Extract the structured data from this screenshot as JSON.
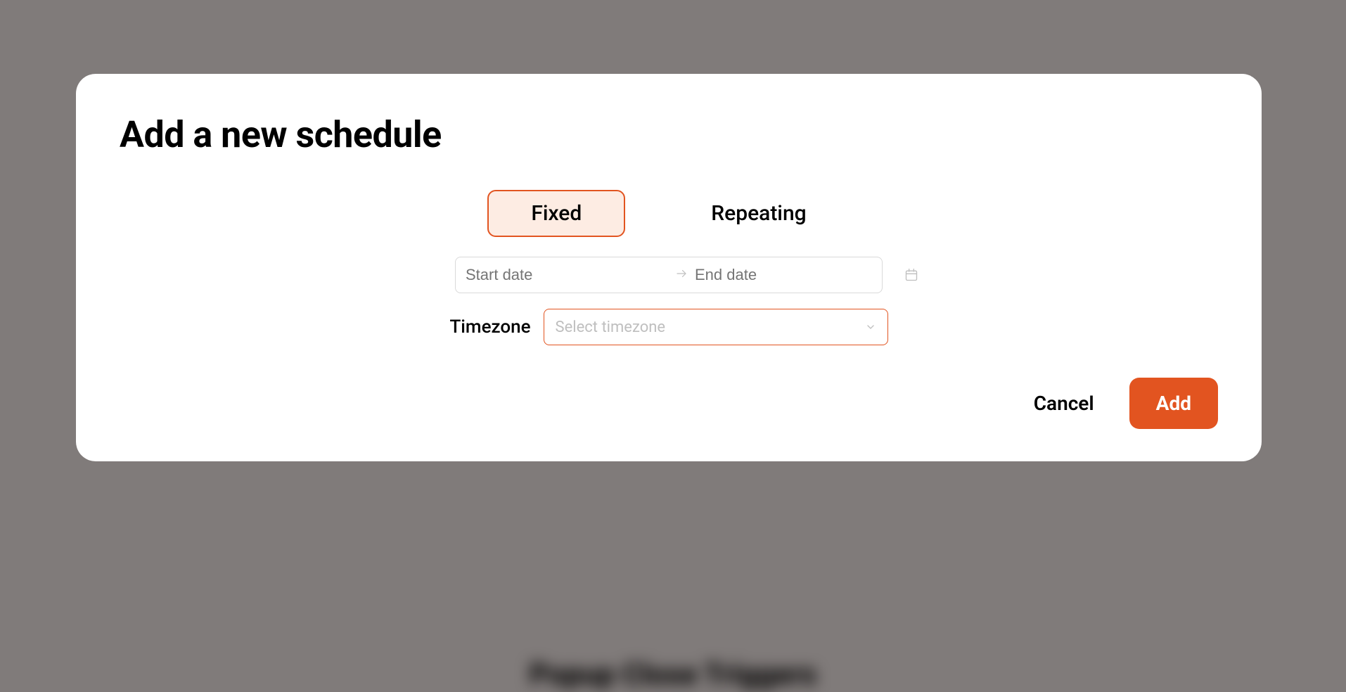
{
  "background_text": "Popup Close Triggers",
  "modal": {
    "title": "Add a new schedule",
    "tabs": {
      "fixed": "Fixed",
      "repeating": "Repeating"
    },
    "date": {
      "start_placeholder": "Start date",
      "end_placeholder": "End date"
    },
    "timezone": {
      "label": "Timezone",
      "placeholder": "Select timezone"
    },
    "actions": {
      "cancel": "Cancel",
      "add": "Add"
    }
  },
  "colors": {
    "accent": "#e25420",
    "accent_bg": "#fdece3",
    "placeholder": "#bfbfbf",
    "backdrop": "#807b7a"
  }
}
